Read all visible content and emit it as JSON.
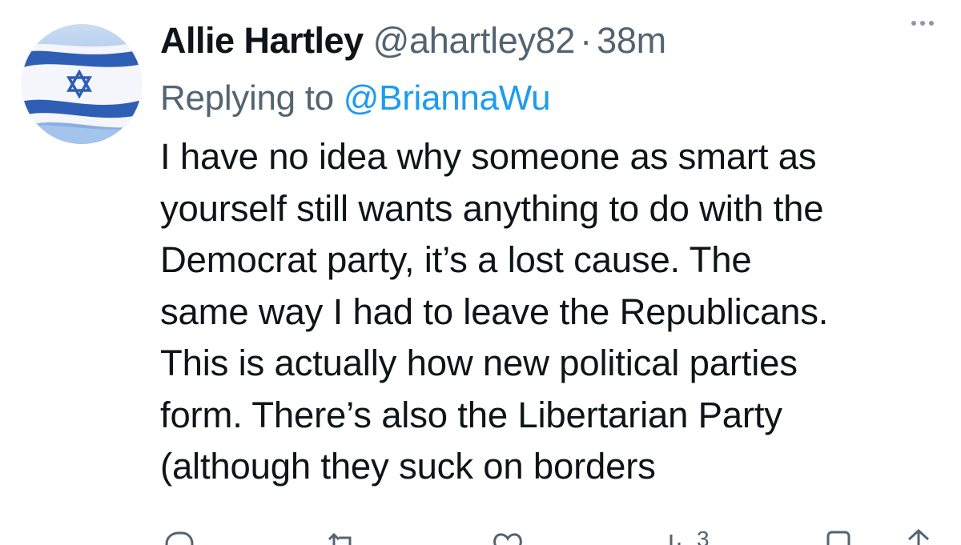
{
  "tweet": {
    "display_name": "Allie Hartley",
    "handle": "@ahartley82",
    "separator": "·",
    "timestamp": "38m",
    "replying_prefix": "Replying to",
    "replying_to": "@BriannaWu",
    "text_lines": [
      "I have no idea why someone as smart as",
      "yourself still wants anything to do with the",
      "Democrat party, it’s a lost cause. The",
      "same way I had to leave the Republicans.",
      "This is actually how new political parties",
      "form. There’s also the Libertarian Party",
      "(although they suck on borders"
    ]
  },
  "avatar": {
    "icon": "israel-flag-avatar",
    "colors": {
      "blue": "#2f5fb5",
      "white": "#ffffff",
      "sky": "#9fc1ea"
    }
  },
  "actions": {
    "reply_icon": "reply-icon",
    "retweet_icon": "retweet-icon",
    "like_icon": "like-icon",
    "views_icon": "views-icon",
    "views_count": "3",
    "bookmark_icon": "bookmark-icon",
    "share_icon": "share-icon"
  },
  "colors": {
    "text": "#0f1419",
    "secondary": "#536471",
    "link": "#1d9bf0"
  }
}
